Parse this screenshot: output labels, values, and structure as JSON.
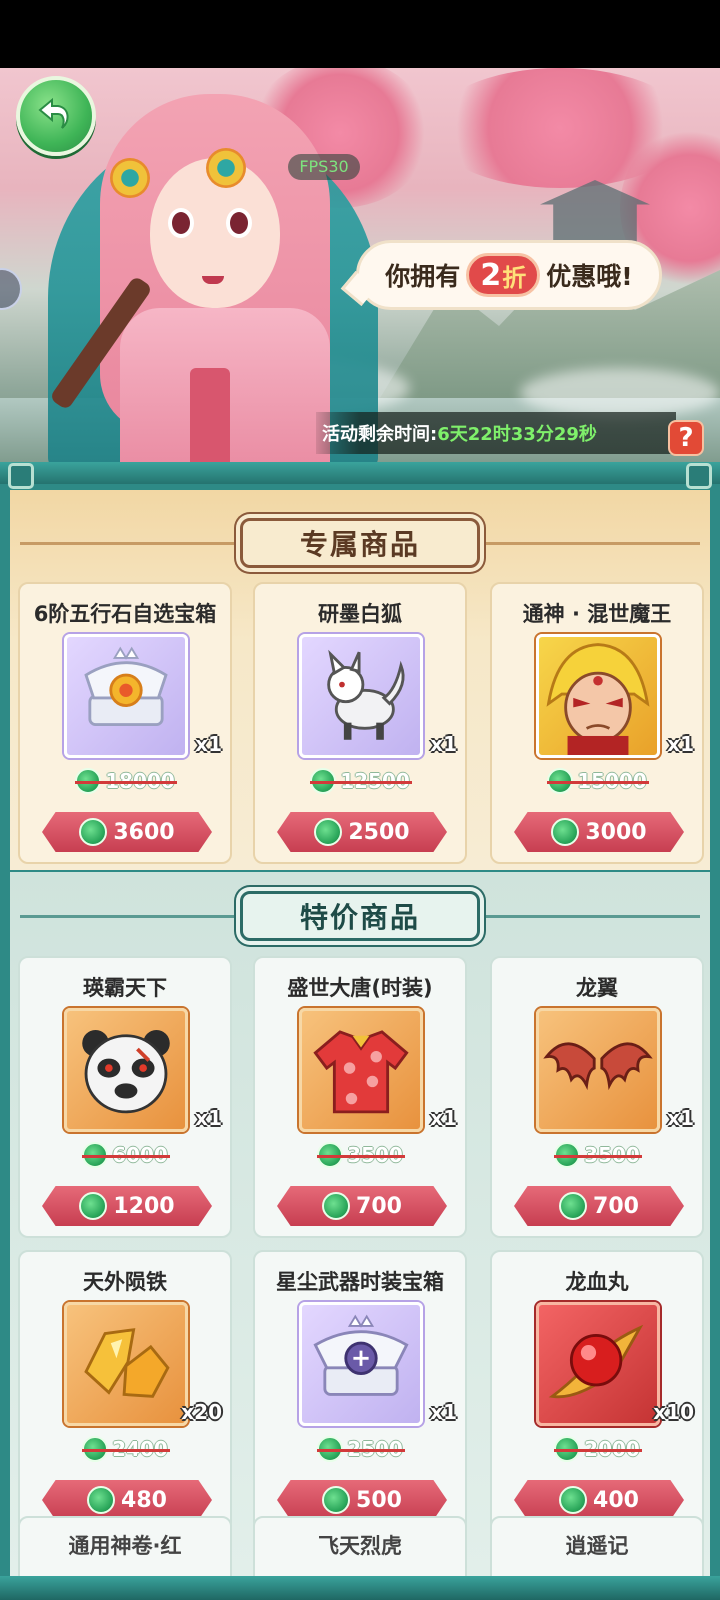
{
  "banner": {
    "fps": "FPS30",
    "speech_prefix": "你拥有",
    "discount_number": "2",
    "discount_unit": "折",
    "speech_suffix": "优惠哦!",
    "timer_label": "活动剩余时间:",
    "timer_value": "6天22时33分29秒",
    "help_label": "?"
  },
  "exclusive": {
    "title": "专属商品",
    "items": [
      {
        "name": "6阶五行石自选宝箱",
        "qty": "x1",
        "original": "18000",
        "price": "3600",
        "icon": "treasure-chest-icon"
      },
      {
        "name": "研墨白狐",
        "qty": "x1",
        "original": "12500",
        "price": "2500",
        "icon": "white-fox-icon"
      },
      {
        "name": "通神 · 混世魔王",
        "qty": "x1",
        "original": "15000",
        "price": "3000",
        "icon": "demon-king-icon"
      }
    ]
  },
  "special": {
    "title": "特价商品",
    "items": [
      {
        "name": "瑛霸天下",
        "qty": "x1",
        "original": "6000",
        "price": "1200",
        "icon": "panda-warrior-icon"
      },
      {
        "name": "盛世大唐(时装)",
        "qty": "x1",
        "original": "3500",
        "price": "700",
        "icon": "red-costume-icon"
      },
      {
        "name": "龙翼",
        "qty": "x1",
        "original": "3500",
        "price": "700",
        "icon": "dragon-wing-icon"
      },
      {
        "name": "天外陨铁",
        "qty": "x20",
        "original": "2400",
        "price": "480",
        "icon": "meteor-iron-icon"
      },
      {
        "name": "星尘武器时装宝箱",
        "qty": "x1",
        "original": "2500",
        "price": "500",
        "icon": "weapon-chest-icon"
      },
      {
        "name": "龙血丸",
        "qty": "x10",
        "original": "2000",
        "price": "400",
        "icon": "dragon-blood-pill-icon"
      }
    ],
    "next_row": [
      "通用神卷·红",
      "飞天烈虎",
      "逍遥记"
    ]
  },
  "colors": {
    "frame": "#2e8a86",
    "price_button": "#c73e51",
    "timer_value": "#7ff06b",
    "jade_coin": "#2aa65a"
  }
}
